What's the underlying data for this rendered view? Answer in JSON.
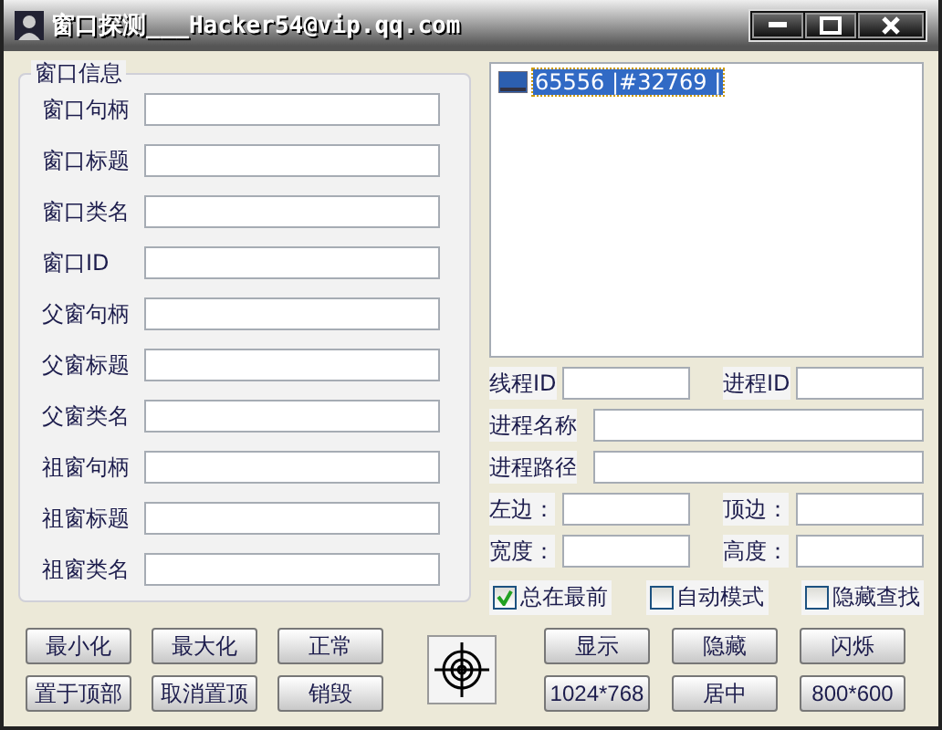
{
  "window": {
    "title": "窗口探测___Hacker54@vip.qq.com"
  },
  "window_info": {
    "title": "窗口信息",
    "fields": [
      {
        "label": "窗口句柄"
      },
      {
        "label": "窗口标题"
      },
      {
        "label": "窗口类名"
      },
      {
        "label": "窗口ID"
      },
      {
        "label": "父窗句柄"
      },
      {
        "label": "父窗标题"
      },
      {
        "label": "父窗类名"
      },
      {
        "label": "祖窗句柄"
      },
      {
        "label": "祖窗标题"
      },
      {
        "label": "祖窗类名"
      }
    ]
  },
  "window_list": [
    {
      "text": "65556 |#32769 |",
      "selected": true
    }
  ],
  "process_fields": [
    [
      {
        "label": "线程ID"
      },
      {
        "label": "进程ID"
      }
    ],
    [
      {
        "label": "进程名称"
      }
    ],
    [
      {
        "label": "进程路径"
      }
    ],
    [
      {
        "label": "左边："
      },
      {
        "label": "顶边："
      }
    ],
    [
      {
        "label": "宽度："
      },
      {
        "label": "高度："
      }
    ]
  ],
  "options": [
    {
      "label": "总在最前",
      "checked": true
    },
    {
      "label": "自动模式",
      "checked": false
    },
    {
      "label": "隐藏查找",
      "checked": false
    }
  ],
  "left_buttons": [
    [
      "最小化",
      "最大化",
      "正常"
    ],
    [
      "置于顶部",
      "取消置顶",
      "销毁"
    ]
  ],
  "right_buttons": [
    [
      "显示",
      "隐藏",
      "闪烁"
    ],
    [
      "1024*768",
      "居中",
      "800*600"
    ]
  ]
}
